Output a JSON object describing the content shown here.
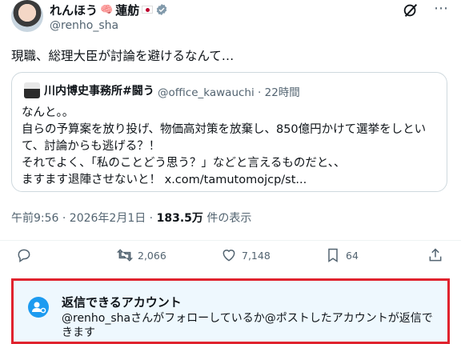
{
  "author": {
    "display_name": "れんほう",
    "emoji": "🧠",
    "display_name_2": "蓮舫",
    "handle": "@renho_sha"
  },
  "post": {
    "text": "現職、総理大臣が討論を避けるなんて…"
  },
  "quote": {
    "name": "川内博史事務所#闘う",
    "meta": "@office_kawauchi · 22時間",
    "lines": [
      "なんと。。",
      "自らの予算案を放り投げ、物価高対策を放棄し、850億円かけて選挙をしといて、討論からも逃げる？！",
      "それでよく、「私のことどう思う？」などと言えるものだと、、",
      "ますます退陣させないと！ x.com/tamutomojcp/st..."
    ]
  },
  "timestamp": {
    "date": "午前9:56 · 2026年2月1日 · ",
    "views": "183.5万",
    "views_label": " 件の表示"
  },
  "actions": {
    "reply_count": "",
    "repost_count": "2,066",
    "like_count": "7,148",
    "bookmark_count": "64"
  },
  "reply_restriction": {
    "title": "返信できるアカウント",
    "description": "@renho_shaさんがフォローしているか@ポストしたアカウントが返信できます"
  },
  "icons": {
    "verified": "verified-badge-icon",
    "grok": "grok-icon",
    "more": "more-icon",
    "reply": "reply-icon",
    "repost": "repost-icon",
    "like": "heart-icon",
    "bookmark": "bookmark-icon",
    "share": "share-icon",
    "reply_restriction": "user-at-icon"
  },
  "colors": {
    "accent": "#1d9bf0",
    "highlight_border": "#e0232e",
    "secondary_text": "#536471"
  }
}
